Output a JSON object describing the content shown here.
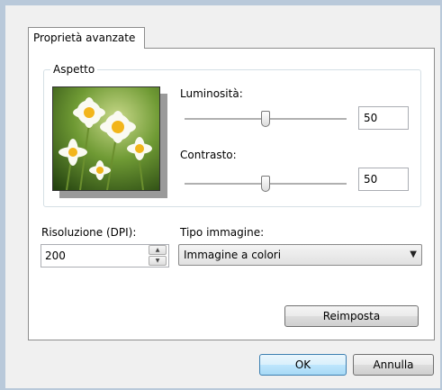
{
  "tab": {
    "label": "Proprietà avanzate"
  },
  "appearance": {
    "title": "Aspetto",
    "brightness": {
      "label": "Luminosità:",
      "value": "50",
      "level": 0.5
    },
    "contrast": {
      "label": "Contrasto:",
      "value": "50",
      "level": 0.5
    }
  },
  "resolution": {
    "label": "Risoluzione (DPI):",
    "value": "200"
  },
  "image_type": {
    "label": "Tipo immagine:",
    "selected": "Immagine a colori"
  },
  "buttons": {
    "reset": "Reimposta",
    "ok": "OK",
    "cancel": "Annulla"
  },
  "colors": {
    "panel": "#ffffff",
    "window": "#f0f0f0",
    "frame": "#b9c9da"
  }
}
